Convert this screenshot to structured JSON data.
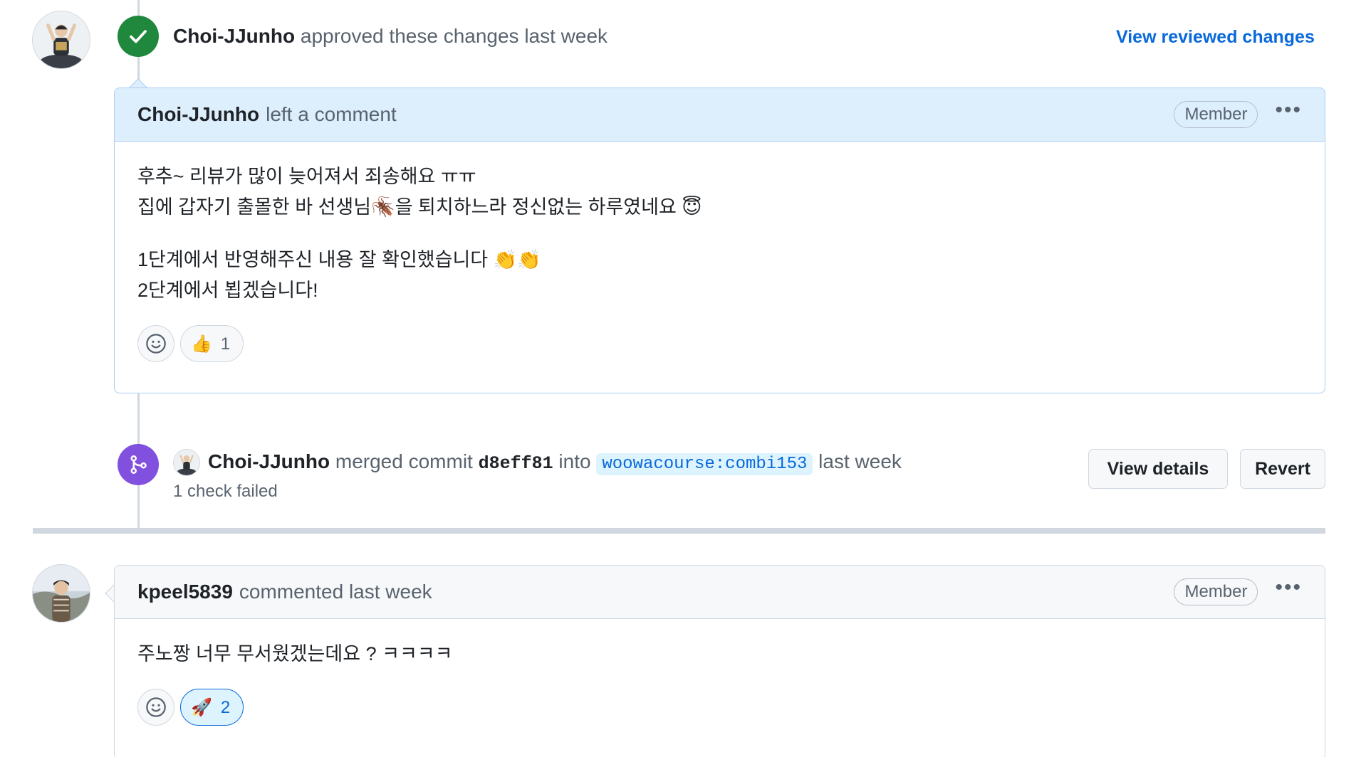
{
  "review_event": {
    "author": "Choi-JJunho",
    "action_text": "approved these changes last week",
    "view_link": "View reviewed changes",
    "icon": "check-icon",
    "color": "#1f883d"
  },
  "comment1": {
    "author": "Choi-JJunho",
    "action_text": "left a comment",
    "badge": "Member",
    "lines": [
      "후추~ 리뷰가 많이 늦어져서 죄송해요 ㅠㅠ",
      "집에 갑자기 출몰한 바 선생님🪳을 퇴치하느라 정신없는 하루였네요 😇",
      "1단계에서 반영해주신 내용 잘 확인했습니다 👏👏",
      "2단계에서 뵙겠습니다!"
    ],
    "reactions": [
      {
        "emoji": "👍",
        "count": "1",
        "active": false
      }
    ]
  },
  "merge_event": {
    "author": "Choi-JJunho",
    "action_text": "merged commit",
    "commit": "d8eff81",
    "into_text": "into",
    "branch": "woowacourse:combi153",
    "time": "last week",
    "status": "1 check failed",
    "details_button": "View details",
    "revert_button": "Revert",
    "color": "#8250df"
  },
  "comment2": {
    "author": "kpeel5839",
    "action_text": "commented last week",
    "badge": "Member",
    "lines": [
      "주노짱 너무 무서웠겠는데요 ? ㅋㅋㅋㅋ"
    ],
    "reactions": [
      {
        "emoji": "🚀",
        "count": "2",
        "active": true
      }
    ]
  }
}
